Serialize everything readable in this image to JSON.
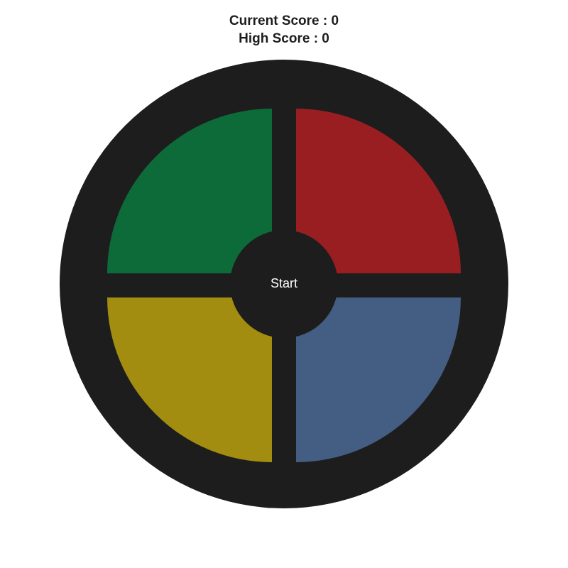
{
  "scoreboard": {
    "current_score_label": "Current Score : 0",
    "high_score_label": "High Score : 0"
  },
  "game": {
    "start_label": "Start",
    "pads": [
      {
        "name": "green",
        "color": "#0d6b3a"
      },
      {
        "name": "red",
        "color": "#991e22"
      },
      {
        "name": "yellow",
        "color": "#a38d11"
      },
      {
        "name": "blue",
        "color": "#445d82"
      }
    ],
    "board_color": "#1d1d1d"
  }
}
